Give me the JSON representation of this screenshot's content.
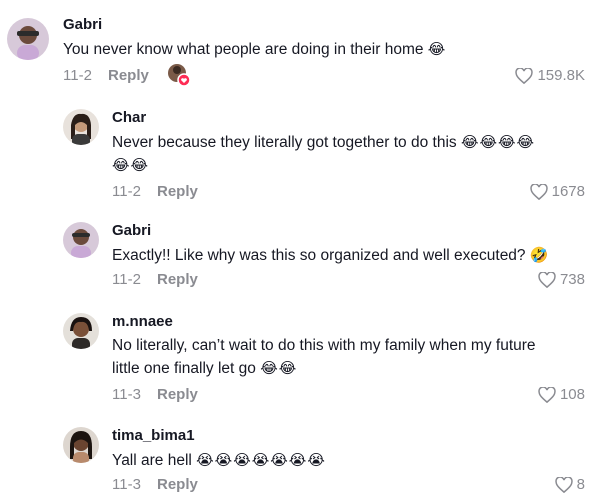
{
  "comments": [
    {
      "username": "Gabri",
      "text": "You never know what people are doing in their home",
      "emojis": "😂",
      "date": "11-2",
      "reply_label": "Reply",
      "likes": "159.8K",
      "liked_by_creator": true
    },
    {
      "username": "Char",
      "text": "Never because they literally got together to do this",
      "emojis": "😂😂😂😂",
      "emojis_line2": "😂😂",
      "date": "11-2",
      "reply_label": "Reply",
      "likes": "1678"
    },
    {
      "username": "Gabri",
      "text": "Exactly!! Like why was this so organized and well executed?",
      "emojis": "🤣",
      "date": "11-2",
      "reply_label": "Reply",
      "likes": "738"
    },
    {
      "username": "m.nnaee",
      "text_line1": "No literally, can’t wait to do this with my family when my future",
      "text_line2": "little one finally let go",
      "emojis": "😂😂",
      "date": "11-3",
      "reply_label": "Reply",
      "likes": "108"
    },
    {
      "username": "tima_bima1",
      "text": "Yall are hell",
      "emojis": "😭😭😭😭😭😭😭",
      "date": "11-3",
      "reply_label": "Reply",
      "likes": "8"
    }
  ],
  "icons": {
    "heart": "heart-outline-icon",
    "badge": "creator-liked-badge-icon"
  },
  "colors": {
    "text": "#161823",
    "muted": "#8a8b91",
    "badge": "#fe2c55"
  }
}
